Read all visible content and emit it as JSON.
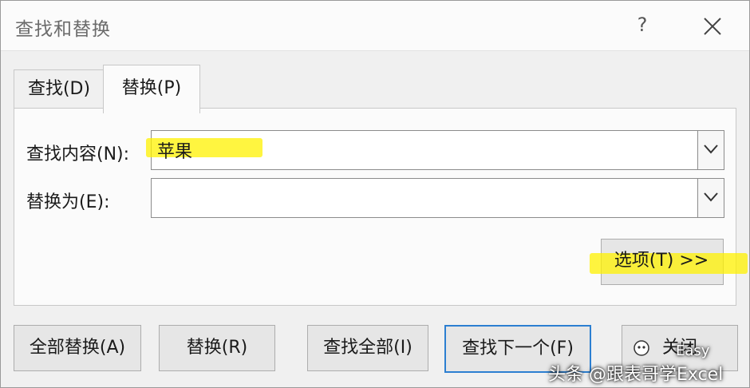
{
  "window": {
    "title": "查找和替换",
    "help": "?",
    "close_icon": "close-icon"
  },
  "tabs": [
    {
      "label": "查找(D)",
      "active": false
    },
    {
      "label": "替换(P)",
      "active": true
    }
  ],
  "find": {
    "label": "查找内容(N):",
    "value": "苹果"
  },
  "replace": {
    "label": "替换为(E):",
    "value": ""
  },
  "options_button": "选项(T) >>",
  "buttons": {
    "replace_all": "全部替换(A)",
    "replace": "替换(R)",
    "find_all": "查找全部(I)",
    "find_next": "查找下一个(F)",
    "close": "关闭"
  },
  "watermark": {
    "line1": "Easy",
    "line2": "头条 @跟表哥学Excel"
  },
  "colors": {
    "highlight": "#fff200",
    "default_button_border": "#2c7fd1"
  }
}
